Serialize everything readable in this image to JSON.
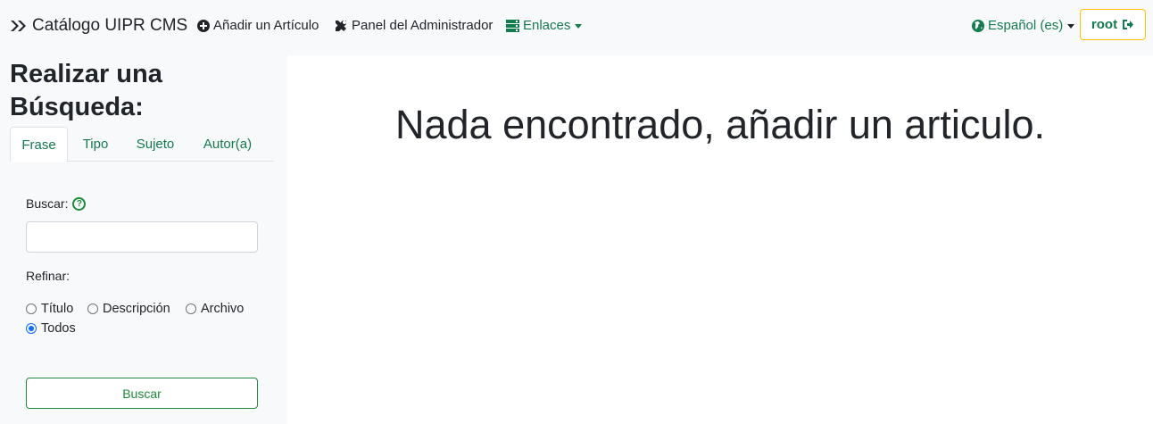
{
  "navbar": {
    "brand": "Catálogo UIPR CMS",
    "add_article": "Añadir un Artículo",
    "admin_panel": "Panel del Administrador",
    "links": "Enlaces",
    "language": "Español (es)",
    "user": "root"
  },
  "sidebar": {
    "title": "Realizar una Búsqueda:",
    "tabs": [
      "Frase",
      "Tipo",
      "Sujeto",
      "Autor(a)"
    ],
    "active_tab": "Frase",
    "search_label": "Buscar:",
    "search_value": "",
    "refine_label": "Refinar:",
    "options": [
      "Título",
      "Descripción",
      "Archivo",
      "Todos"
    ],
    "selected_option": "Todos",
    "search_button": "Buscar"
  },
  "main": {
    "message": "Nada encontrado, añadir un articulo."
  },
  "colors": {
    "accent": "#137b4e",
    "button_green": "#1e8a3c",
    "root_border": "#ffc107",
    "radio_checked": "#0d6efd"
  }
}
